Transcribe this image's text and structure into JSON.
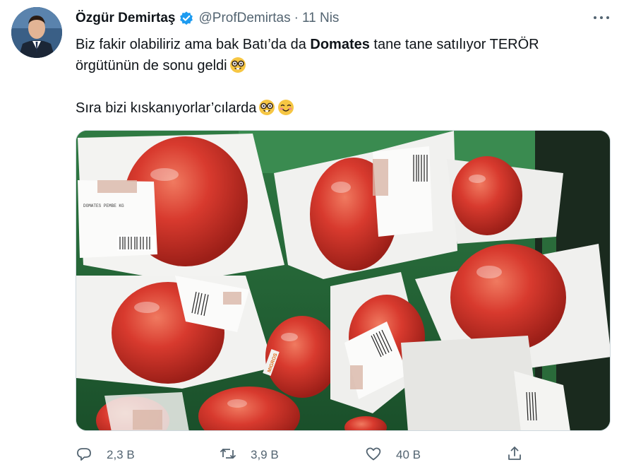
{
  "author": {
    "name": "Özgür Demirtaş",
    "handle": "@ProfDemirtas",
    "separator": "·",
    "date": "11 Nis"
  },
  "tweet": {
    "line1_a": "Biz fakir olabiliriz ama bak Batı’da da ",
    "line1_bold": "Domates",
    "line1_b": " tane tane satılıyor TERÖR",
    "line2": "örgütünün de sonu geldi",
    "line3": "Sıra bizi kıskanıyorlar’cılarda"
  },
  "image": {
    "label_text": "DOMATES PEMBE KG",
    "store_text": "MIGROS"
  },
  "actions": {
    "reply_count": "2,3 B",
    "retweet_count": "3,9 B",
    "like_count": "40 B"
  },
  "colors": {
    "verified": "#1d9bf0",
    "muted": "#536471",
    "tomato": "#d83a2e"
  },
  "icons": [
    "verified-icon",
    "more-icon",
    "nerd-face-icon",
    "smiling-blush-icon",
    "reply-icon",
    "retweet-icon",
    "like-icon",
    "share-icon"
  ]
}
